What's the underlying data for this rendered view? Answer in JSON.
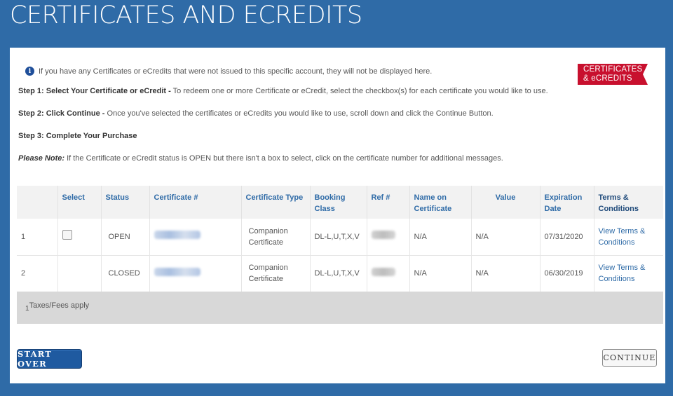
{
  "page": {
    "title": "CERTIFICATES AND ECREDITS"
  },
  "info": {
    "icon": "info-icon",
    "text": "If you have any Certificates or eCredits that were not issued to this specific account, they will not be displayed here."
  },
  "logo": {
    "line1": "CERTIFICATES",
    "line2": "& eCREDITS",
    "color": "#c8102e"
  },
  "steps": {
    "step1_label": "Step 1: Select Your Certificate or eCredit -",
    "step1_text": " To redeem one or more Certificate or eCredit, select the checkbox(s) for each certificate you would like to use.",
    "step2_label": "Step 2: Click Continue -",
    "step2_text": " Once you've selected the certificates or eCredits you would like to use, scroll down and click the Continue Button.",
    "step3_label": "Step 3: Complete Your Purchase",
    "note_label": "Please Note:",
    "note_text": " If the Certificate or eCredit status is OPEN but there isn't a box to select, click on the certificate number for additional messages."
  },
  "table": {
    "headers": {
      "select": "Select",
      "status": "Status",
      "certificate": "Certificate #",
      "type": "Certificate Type",
      "booking_class": "Booking Class",
      "ref": "Ref #",
      "name": "Name on Certificate",
      "value": "Value",
      "expiration": "Expiration Date",
      "terms": "Terms & Conditions"
    },
    "rows": [
      {
        "num": "1",
        "has_checkbox": true,
        "status": "OPEN",
        "type": "Companion Certificate",
        "booking_class": "DL-L,U,T,X,V",
        "name": "N/A",
        "value": "N/A",
        "expiration": "07/31/2020",
        "terms": "View Terms & Conditions"
      },
      {
        "num": "2",
        "has_checkbox": false,
        "status": "CLOSED",
        "type": "Companion Certificate",
        "booking_class": "DL-L,U,T,X,V",
        "name": "N/A",
        "value": "N/A",
        "expiration": "06/30/2019",
        "terms": "View Terms & Conditions"
      }
    ],
    "footnote_mark": "1",
    "footnote": "Taxes/Fees apply"
  },
  "buttons": {
    "start_over": "START OVER",
    "continue": "CONTINUE"
  },
  "colors": {
    "background": "#2f6ba7",
    "link": "#2f6ba7",
    "primary_button": "#1f5aa0"
  }
}
